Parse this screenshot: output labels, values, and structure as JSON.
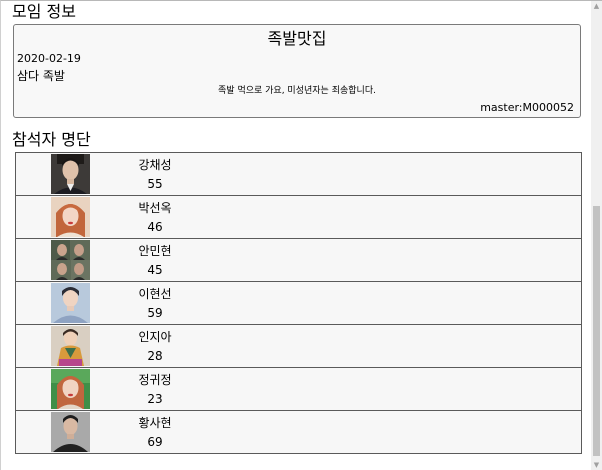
{
  "meeting": {
    "heading": "모임 정보",
    "name": "족발맛집",
    "date": "2020-02-19",
    "place": "삼다 족발",
    "description": "족발 먹으로 가요, 미성년자는 죄송합니다.",
    "master": "master:M000052"
  },
  "attendees": {
    "heading": "참석자 명단",
    "items": [
      {
        "name": "강채성",
        "age": "55"
      },
      {
        "name": "박선옥",
        "age": "46"
      },
      {
        "name": "안민현",
        "age": "45"
      },
      {
        "name": "이현선",
        "age": "59"
      },
      {
        "name": "인지아",
        "age": "28"
      },
      {
        "name": "정귀정",
        "age": "23"
      },
      {
        "name": "황사현",
        "age": "69"
      }
    ]
  },
  "colors": {
    "row_background": "#f7f7f7",
    "border": "#5a5a5a"
  }
}
